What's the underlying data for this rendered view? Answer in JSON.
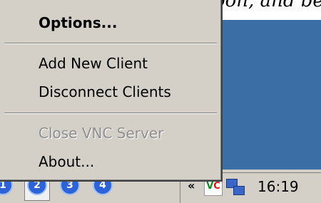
{
  "background_text": "oon, and be seen - a di view",
  "menu": {
    "items": [
      {
        "label": "Options...",
        "bold": true,
        "enabled": true
      },
      {
        "label": "Add New Client",
        "enabled": true
      },
      {
        "label": "Disconnect Clients",
        "enabled": true
      },
      {
        "label": "Close VNC Server",
        "enabled": false
      },
      {
        "label": "About...",
        "enabled": true
      }
    ]
  },
  "taskbar": {
    "quick_launch": [
      "1",
      "2",
      "3",
      "4"
    ],
    "tray": {
      "chevron": "«",
      "vnc_icon_text": {
        "v": "V",
        "c": "C"
      },
      "clock": "16:19"
    }
  },
  "colors": {
    "desktop": "#3a6ea5",
    "menu_bg": "#d4d0c8",
    "disabled_text": "#8f8f8f"
  }
}
